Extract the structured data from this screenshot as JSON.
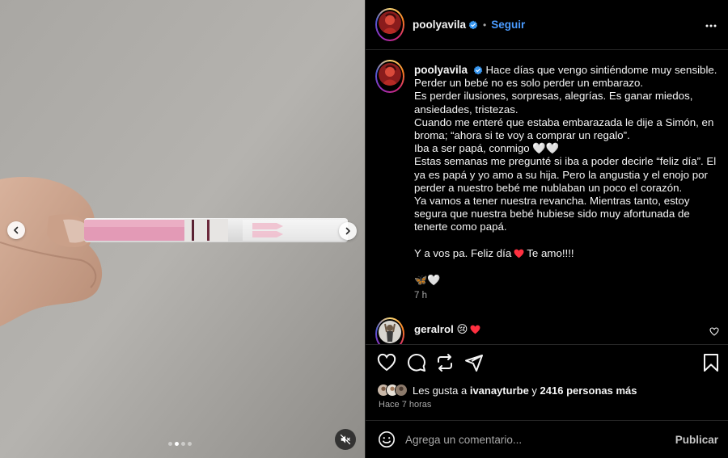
{
  "post": {
    "username": "poolyavila",
    "follow_label": "Seguir",
    "separator": "•",
    "verified": true
  },
  "media": {
    "slides_total": 4,
    "active_slide": 2,
    "icons": [
      "chevron-left-icon",
      "chevron-right-icon",
      "speaker-muted-icon"
    ]
  },
  "caption": {
    "username": "poolyavila",
    "lines": [
      "Hace días que vengo sintiéndome muy sensible.",
      "Perder un bebé no es solo perder un embarazo.",
      "Es perder ilusiones, sorpresas, alegrías. Es ganar miedos, ansiedades, tristezas.",
      "Cuando me enteré que estaba embarazada le dije a Simón, en broma; “ahora si te voy a comprar un regalo”.",
      "Iba a ser papá, conmigo 🤍🤍",
      "Estas semanas me pregunté si iba a poder decirle “feliz día”. El ya es papá y yo amo a su hija. Pero la angustia y el enojo por perder a nuestro bebé me nublaban un poco el corazón.",
      "Ya vamos a tener nuestra revancha. Mientras tanto, estoy segura que nuestra bebé hubiese sido muy afortunada de tenerte como papá."
    ],
    "closing_before": "Y a vos pa. Feliz día",
    "closing_after": "Te amo!!!!",
    "emojis": "🦋🤍",
    "time": "7 h"
  },
  "comment": {
    "username": "geralrol",
    "emojis": "😢"
  },
  "engagement": {
    "likes_prefix": "Les gusta a ",
    "liked_by": "ivanayturbe",
    "likes_mid": " y ",
    "likes_count": "2416 personas más",
    "posted": "Hace 7 horas"
  },
  "composer": {
    "placeholder": "Agrega un comentario...",
    "post_label": "Publicar"
  },
  "colors": {
    "link": "#4a9bff",
    "verified": "#3897f0",
    "like_red": "#ff3040",
    "background": "#000000",
    "muted_text": "#a8a8a8"
  }
}
